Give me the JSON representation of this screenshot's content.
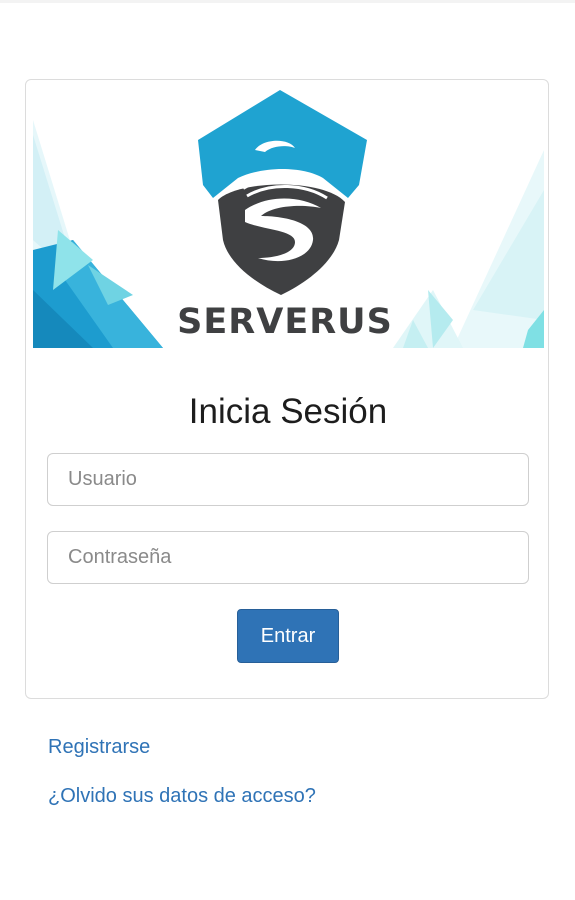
{
  "logo": {
    "brand_text": "SERVERUS",
    "icon": "serverus-shield-logo"
  },
  "login": {
    "title": "Inicia Sesión",
    "username_placeholder": "Usuario",
    "password_placeholder": "Contraseña",
    "submit_label": "Entrar"
  },
  "links": {
    "register": "Registrarse",
    "forgot": "¿Olvido sus datos de acceso?"
  },
  "colors": {
    "primary": "#2f73b6",
    "logo_blue": "#1fa3d1",
    "logo_dark": "#3f4042",
    "accent_teal": "#7fe0e4"
  }
}
